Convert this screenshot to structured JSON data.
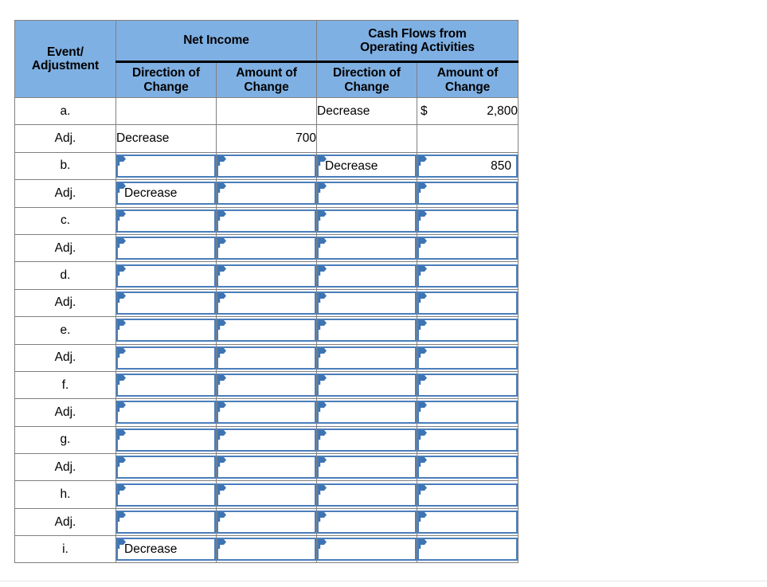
{
  "table": {
    "headers": {
      "event_adjustment": "Event/\nAdjustment",
      "net_income": "Net Income",
      "cash_flows": "Cash Flows from\nOperating Activities",
      "direction_of_change": "Direction of\nChange",
      "amount_of_change": "Amount of\nChange"
    },
    "header_line1": {
      "event": "Event/",
      "net_income": "Net Income",
      "cash_flows": "Cash Flows from"
    },
    "header_line2": {
      "adjustment": "Adjustment",
      "cash_flows": "Operating Activities"
    },
    "sub_headers": {
      "ni_dir_l1": "Direction of",
      "ni_dir_l2": "Change",
      "ni_amt_l1": "Amount of",
      "ni_amt_l2": "Change",
      "cf_dir_l1": "Direction of",
      "cf_dir_l2": "Change",
      "cf_amt_l1": "Amount of",
      "cf_amt_l2": "Change"
    },
    "currency_symbol": "$",
    "rows": [
      {
        "label": "a.",
        "input": false,
        "ni_direction": "",
        "ni_amount": "",
        "cf_direction": "Decrease",
        "cf_amount": "2,800",
        "cf_amount_has_dollar": true
      },
      {
        "label": "Adj.",
        "input": false,
        "ni_direction": "Decrease",
        "ni_amount": "700",
        "cf_direction": "",
        "cf_amount": "",
        "cf_amount_has_dollar": false
      },
      {
        "label": "b.",
        "input": true,
        "ni_direction": "",
        "ni_amount": "",
        "cf_direction": "Decrease",
        "cf_amount": "850",
        "cf_amount_has_dollar": false
      },
      {
        "label": "Adj.",
        "input": true,
        "ni_direction": "Decrease",
        "ni_amount": "",
        "cf_direction": "",
        "cf_amount": "",
        "cf_amount_has_dollar": false
      },
      {
        "label": "c.",
        "input": true,
        "ni_direction": "",
        "ni_amount": "",
        "cf_direction": "",
        "cf_amount": "",
        "cf_amount_has_dollar": false
      },
      {
        "label": "Adj.",
        "input": true,
        "ni_direction": "",
        "ni_amount": "",
        "cf_direction": "",
        "cf_amount": "",
        "cf_amount_has_dollar": false
      },
      {
        "label": "d.",
        "input": true,
        "ni_direction": "",
        "ni_amount": "",
        "cf_direction": "",
        "cf_amount": "",
        "cf_amount_has_dollar": false
      },
      {
        "label": "Adj.",
        "input": true,
        "ni_direction": "",
        "ni_amount": "",
        "cf_direction": "",
        "cf_amount": "",
        "cf_amount_has_dollar": false
      },
      {
        "label": "e.",
        "input": true,
        "ni_direction": "",
        "ni_amount": "",
        "cf_direction": "",
        "cf_amount": "",
        "cf_amount_has_dollar": false
      },
      {
        "label": "Adj.",
        "input": true,
        "ni_direction": "",
        "ni_amount": "",
        "cf_direction": "",
        "cf_amount": "",
        "cf_amount_has_dollar": false
      },
      {
        "label": "f.",
        "input": true,
        "ni_direction": "",
        "ni_amount": "",
        "cf_direction": "",
        "cf_amount": "",
        "cf_amount_has_dollar": false
      },
      {
        "label": "Adj.",
        "input": true,
        "ni_direction": "",
        "ni_amount": "",
        "cf_direction": "",
        "cf_amount": "",
        "cf_amount_has_dollar": false
      },
      {
        "label": "g.",
        "input": true,
        "ni_direction": "",
        "ni_amount": "",
        "cf_direction": "",
        "cf_amount": "",
        "cf_amount_has_dollar": false
      },
      {
        "label": "Adj.",
        "input": true,
        "ni_direction": "",
        "ni_amount": "",
        "cf_direction": "",
        "cf_amount": "",
        "cf_amount_has_dollar": false
      },
      {
        "label": "h.",
        "input": true,
        "ni_direction": "",
        "ni_amount": "",
        "cf_direction": "",
        "cf_amount": "",
        "cf_amount_has_dollar": false
      },
      {
        "label": "Adj.",
        "input": true,
        "ni_direction": "",
        "ni_amount": "",
        "cf_direction": "",
        "cf_amount": "",
        "cf_amount_has_dollar": false
      },
      {
        "label": "i.",
        "input": true,
        "ni_direction": "Decrease",
        "ni_amount": "",
        "cf_direction": "",
        "cf_amount": "",
        "cf_amount_has_dollar": false
      }
    ]
  },
  "colors": {
    "header_fill": "#7FB0E3",
    "grid_line": "#808080",
    "input_border": "#4A7EBB",
    "flag_marker": "#3D74B3",
    "divider": "#e6e6e6",
    "page_background": "#ffffff"
  },
  "icons": {
    "dropdown_flag": "dropdown-flag-icon"
  }
}
